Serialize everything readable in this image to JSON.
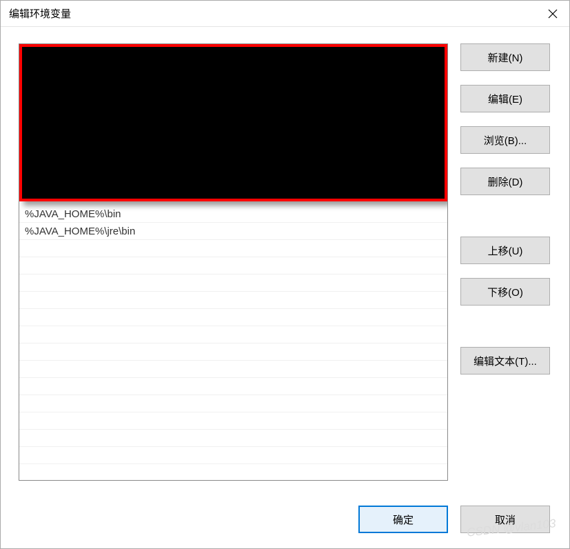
{
  "window": {
    "title": "编辑环境变量"
  },
  "list": {
    "items": [
      "%JAVA_HOME%\\bin",
      "%JAVA_HOME%\\jre\\bin"
    ]
  },
  "buttons": {
    "new": "新建(N)",
    "edit": "编辑(E)",
    "browse": "浏览(B)...",
    "delete": "删除(D)",
    "move_up": "上移(U)",
    "move_down": "下移(O)",
    "edit_text": "编辑文本(T)..."
  },
  "footer": {
    "ok": "确定",
    "cancel": "取消"
  },
  "watermark": "CSDN @vlan103"
}
